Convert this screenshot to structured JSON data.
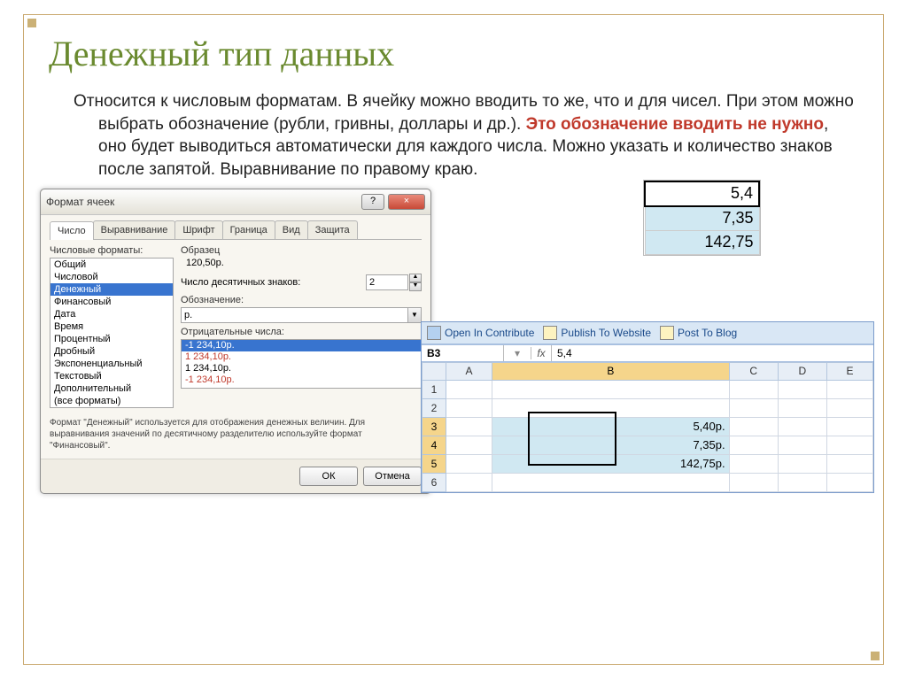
{
  "title": "Денежный тип данных",
  "para_a": "Относится к числовым форматам. В ячейку можно вводить то же, что и для чисел. При этом можно выбрать обозначение (рубли, гривны, доллары и др.). ",
  "para_red": "Это обозначение вводить не нужно",
  "para_b": ", оно будет выводиться автоматически для каждого числа. Можно указать и количество знаков после запятой. Выравнивание по правому краю.",
  "dialog": {
    "caption": "Формат ячеек",
    "help": "?",
    "close": "×",
    "tabs": [
      "Число",
      "Выравнивание",
      "Шрифт",
      "Граница",
      "Вид",
      "Защита"
    ],
    "listLabel": "Числовые форматы:",
    "list": [
      "Общий",
      "Числовой",
      "Денежный",
      "Финансовый",
      "Дата",
      "Время",
      "Процентный",
      "Дробный",
      "Экспоненциальный",
      "Текстовый",
      "Дополнительный",
      "(все форматы)"
    ],
    "sampleLabel": "Образец",
    "sample": "120,50р.",
    "decimalsLabel": "Число десятичных знаков:",
    "decimals": "2",
    "symbolLabel": "Обозначение:",
    "symbol": "р.",
    "negLabel": "Отрицательные числа:",
    "neg": [
      "-1 234,10р.",
      "1 234,10р.",
      "1 234,10р.",
      "-1 234,10р."
    ],
    "desc": "Формат \"Денежный\" используется для отображения денежных величин. Для выравнивания значений по десятичному разделителю используйте формат \"Финансовый\".",
    "ok": "ОК",
    "cancel": "Отмена"
  },
  "cellsTop": {
    "r1": "5,4",
    "r2": "7,35",
    "r3": "142,75"
  },
  "excel": {
    "toolbar": {
      "ct": "Open In Contribute",
      "pub": "Publish To Website",
      "blog": "Post To Blog"
    },
    "namebox": "B3",
    "fx": "fx",
    "fval": "5,4",
    "cols": [
      "A",
      "B",
      "C",
      "D",
      "E"
    ],
    "rows": {
      "r1": "",
      "r2": "",
      "r3": "5,40р.",
      "r4": "7,35р.",
      "r5": "142,75р.",
      "r6": ""
    }
  }
}
